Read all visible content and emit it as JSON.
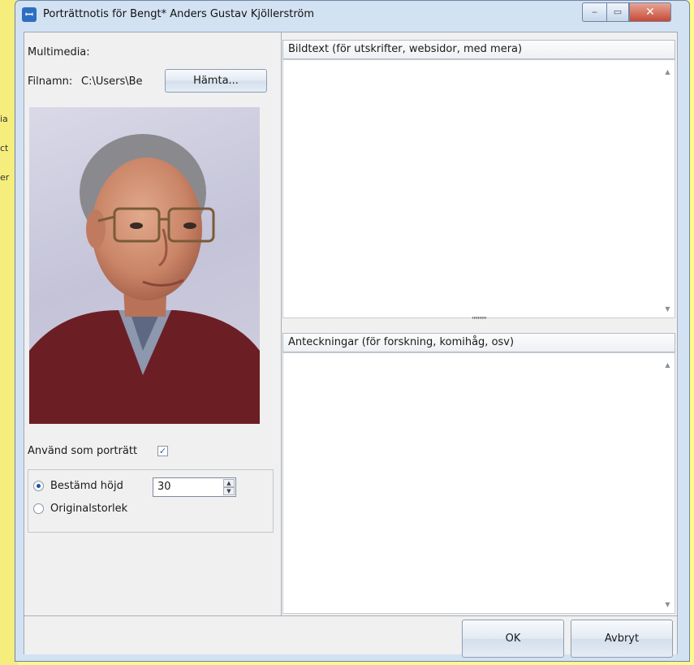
{
  "window": {
    "title": "Porträttnotis för Bengt* Anders Gustav Kjöllerström",
    "app_icon_glyph": "ꟷ",
    "controls": {
      "minimize": "‒",
      "maximize": "▭",
      "close": "✕"
    }
  },
  "background_fragments": [
    "ia",
    "ct",
    "er"
  ],
  "left": {
    "multimedia_label": "Multimedia:",
    "filename_label": "Filnamn:",
    "filename_value": "C:\\Users\\Be",
    "fetch_button": "Hämta...",
    "use_as_portrait_label": "Använd som porträtt",
    "use_as_portrait_checked": true,
    "size_options": [
      {
        "label": "Bestämd höjd",
        "selected": true
      },
      {
        "label": "Originalstorlek",
        "selected": false
      }
    ],
    "height_value": "30"
  },
  "right": {
    "caption_header": "Bildtext (för utskrifter, websidor, med mera)",
    "caption_text": "",
    "notes_header": "Anteckningar (för forskning, komihåg, osv)",
    "notes_text": ""
  },
  "footer": {
    "ok_button": "OK",
    "cancel_button": "Avbryt"
  },
  "colors": {
    "background_yellow": "#fdf98a",
    "window_frame": "#d3e2f3",
    "close_button_red": "#c74a35"
  }
}
